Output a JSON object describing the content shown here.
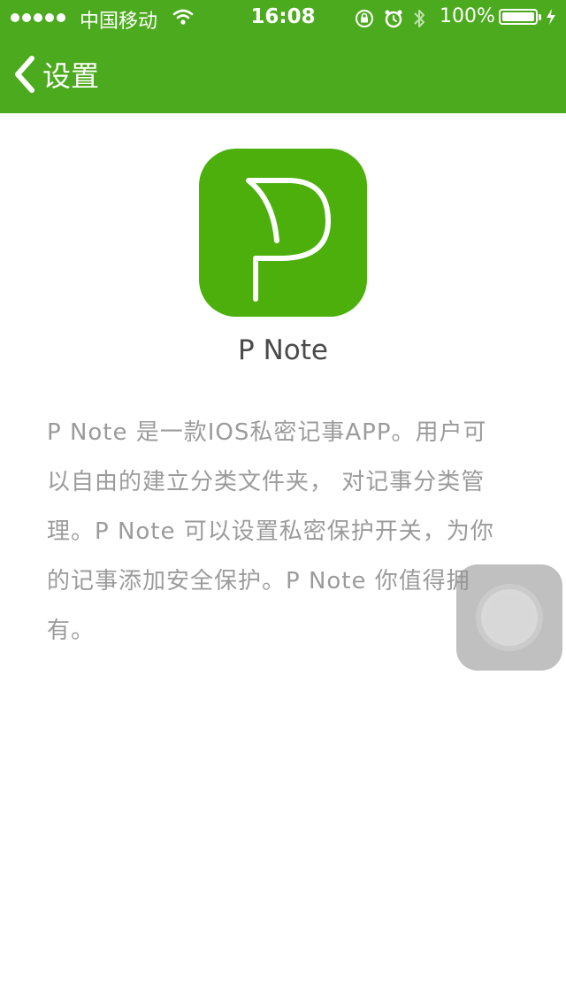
{
  "status_bar": {
    "carrier": "中国移动",
    "time": "16:08",
    "battery_percent": "100%",
    "battery_level": 1.0,
    "icons": [
      "signal-dots-icon",
      "wifi-icon",
      "rotation-lock-icon",
      "alarm-icon",
      "bluetooth-icon",
      "battery-icon",
      "charging-bolt-icon"
    ]
  },
  "nav": {
    "back_icon": "chevron-left-icon",
    "back_label": "设置"
  },
  "about": {
    "app_icon": "p-note-logo",
    "app_name": "P Note",
    "description_lines": [
      "P Note 是一款IOS私密记事APP。用户可",
      "以自由的建立分类文件夹， 对记事分类管",
      "理。P Note 可以设置私密保护开关，为你",
      "的记事添加安全保护。P Note 你值得拥",
      "有。"
    ]
  },
  "assistive_touch": {
    "icon": "assistive-touch-icon"
  },
  "colors": {
    "nav_bar": "#4caa1e",
    "app_icon_bg": "#4caf0c",
    "description_text": "#9b9b9b",
    "title_text": "#4a4a4a"
  }
}
